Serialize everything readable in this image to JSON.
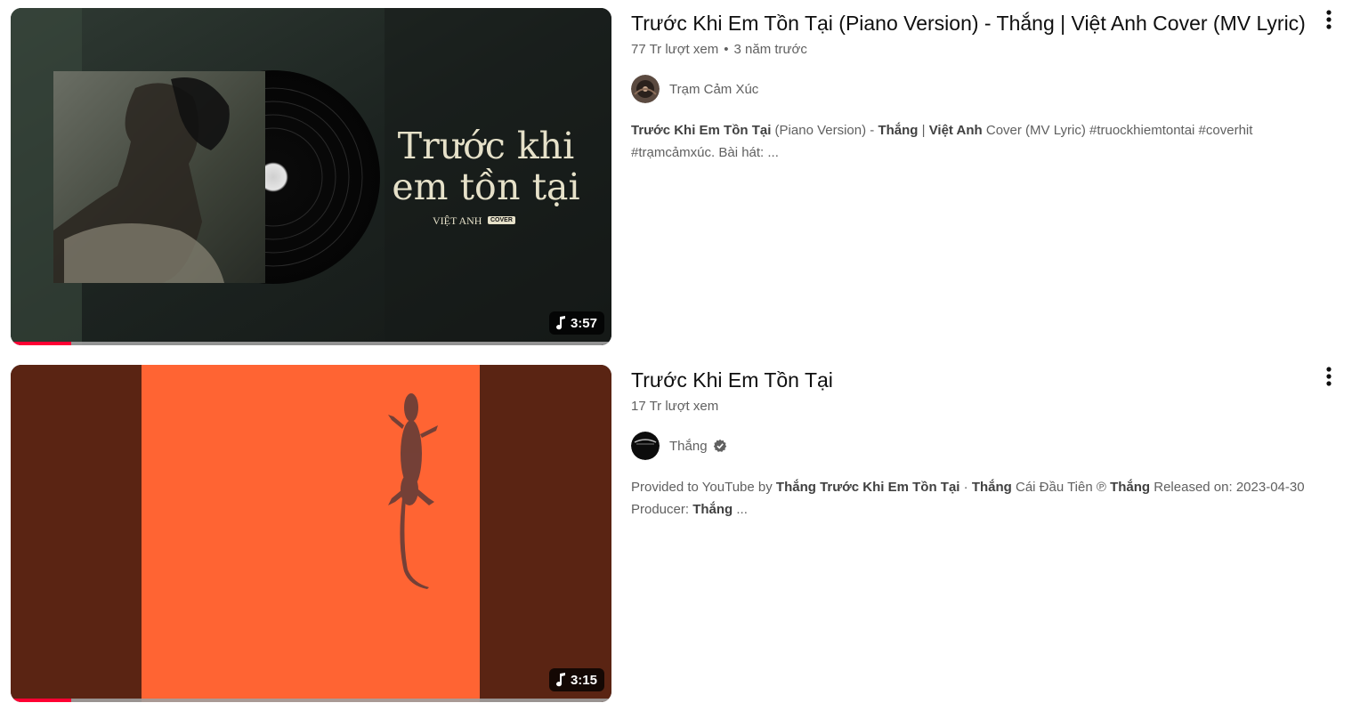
{
  "videos": [
    {
      "title": "Trước Khi Em Tồn Tại (Piano Version) - Thắng | Việt Anh Cover (MV Lyric)",
      "views": "77 Tr lượt xem",
      "age": "3 năm trước",
      "channel": "Trạm Cảm Xúc",
      "verified": false,
      "duration": "3:57",
      "watched_fraction": 0.1,
      "thumbnail_text": {
        "title_line1": "Trước khi",
        "title_line2": "em tồn tại",
        "artist": "VIỆT ANH",
        "badge": "COVER"
      },
      "description": {
        "b1": "Trước Khi Em Tồn Tại",
        "t1": " (Piano Version) - ",
        "b2": "Thắng",
        "t2": " | ",
        "b3": "Việt Anh",
        "t3": " Cover (MV Lyric) #truockhiemtontai #coverhit #trạmcảmxúc. Bài hát: ..."
      }
    },
    {
      "title": "Trước Khi Em Tồn Tại",
      "views": "17 Tr lượt xem",
      "channel": "Thắng",
      "verified": true,
      "duration": "3:15",
      "watched_fraction": 0.1,
      "description": {
        "t1": "Provided to YouTube by ",
        "b1": "Thắng",
        "t1b": " ",
        "b2": "Trước Khi Em Tồn Tại",
        "t2": " · ",
        "b3": "Thắng",
        "t3": " Cái Đầu Tiên ℗ ",
        "b4": "Thắng",
        "t4": " Released on: 2023-04-30 Producer: ",
        "b5": "Thắng",
        "t5": " ..."
      }
    }
  ],
  "colors": {
    "progress": "#ff0033",
    "meta_text": "#606060",
    "orange": "#ff6433",
    "dark_brown": "#5a2413"
  },
  "icons": {
    "more": "vertical-ellipsis-icon",
    "music": "music-note-icon",
    "verified": "verified-check-icon"
  }
}
